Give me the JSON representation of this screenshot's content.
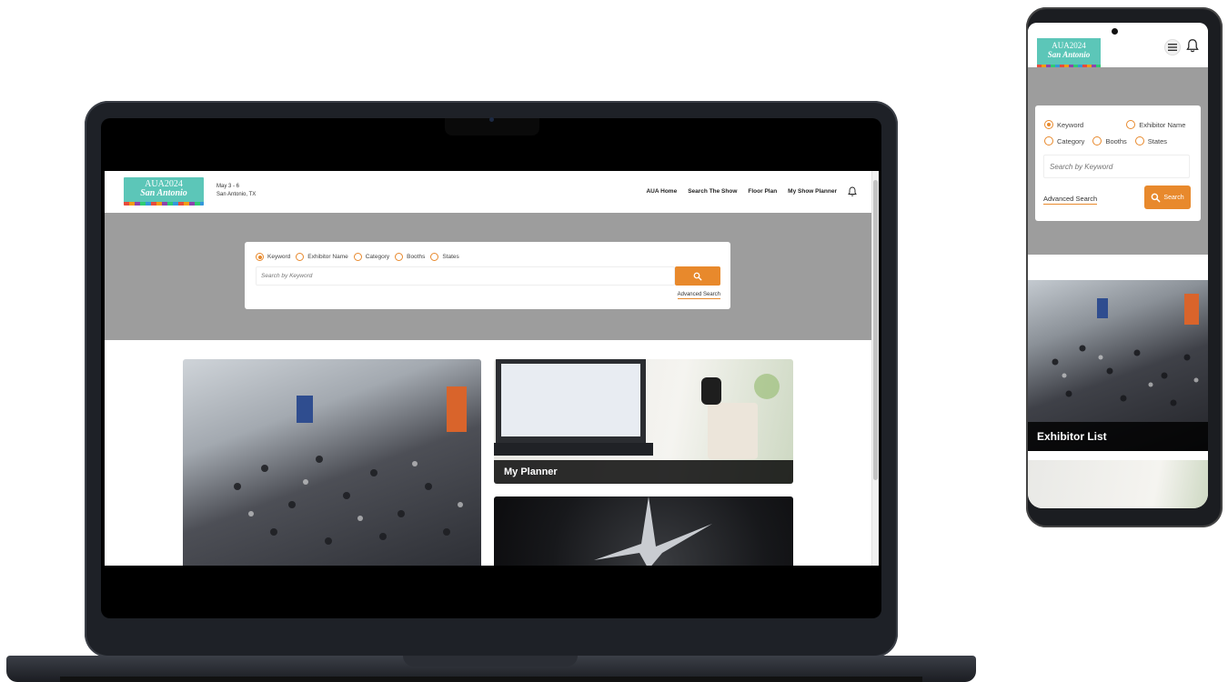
{
  "desktop": {
    "logo": {
      "line1": "AUA2024",
      "line2": "San Antonio"
    },
    "event": {
      "dates": "May 3 - 6",
      "location": "San Antonio, TX"
    },
    "nav": [
      "AUA Home",
      "Search The Show",
      "Floor Plan",
      "My Show Planner"
    ],
    "search": {
      "options": [
        "Keyword",
        "Exhibitor Name",
        "Category",
        "Booths",
        "States"
      ],
      "selected": "Keyword",
      "placeholder": "Search by Keyword",
      "advanced_label": "Advanced Search"
    },
    "tiles": [
      {
        "caption": ""
      },
      {
        "caption": "My Planner"
      },
      {
        "caption": ""
      }
    ]
  },
  "mobile": {
    "logo": {
      "line1": "AUA2024",
      "line2": "San Antonio"
    },
    "search": {
      "options": [
        "Keyword",
        "Exhibitor Name",
        "Category",
        "Booths",
        "States"
      ],
      "selected": "Keyword",
      "placeholder": "Search by Keyword",
      "advanced_label": "Advanced Search",
      "button_label": "Search"
    },
    "tiles": [
      {
        "caption": "Exhibitor List"
      }
    ]
  },
  "colors": {
    "accent": "#e8892c",
    "hero_gray": "#9d9d9d",
    "logo_teal": "#5cc6b8"
  },
  "icons": {
    "search": "search-icon",
    "notifications": "bell-icon",
    "menu": "hamburger-menu-icon"
  }
}
